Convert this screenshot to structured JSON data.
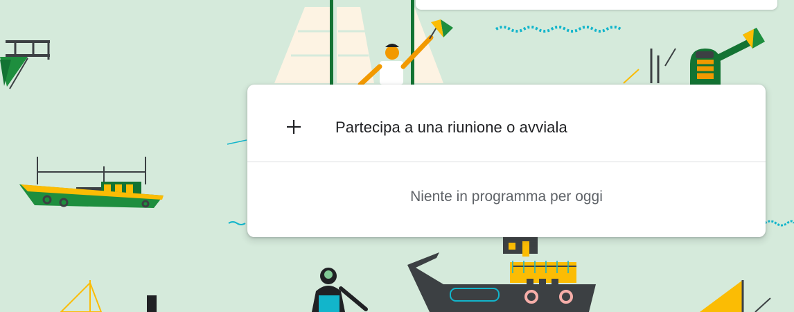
{
  "background": {
    "color": "#d5eadb",
    "illustration": "harbor-scene"
  },
  "join_card": {
    "join_label": "Partecipa a una riunione o avviala",
    "join_icon": "plus-icon",
    "empty_message": "Niente in programma per oggi"
  },
  "colors": {
    "text_primary": "#202124",
    "text_secondary": "#5f6368",
    "divider": "#dadce0",
    "accent_green": "#1e8e3e",
    "accent_yellow": "#fbbc04",
    "accent_orange": "#f29900",
    "dark": "#3c4043"
  }
}
